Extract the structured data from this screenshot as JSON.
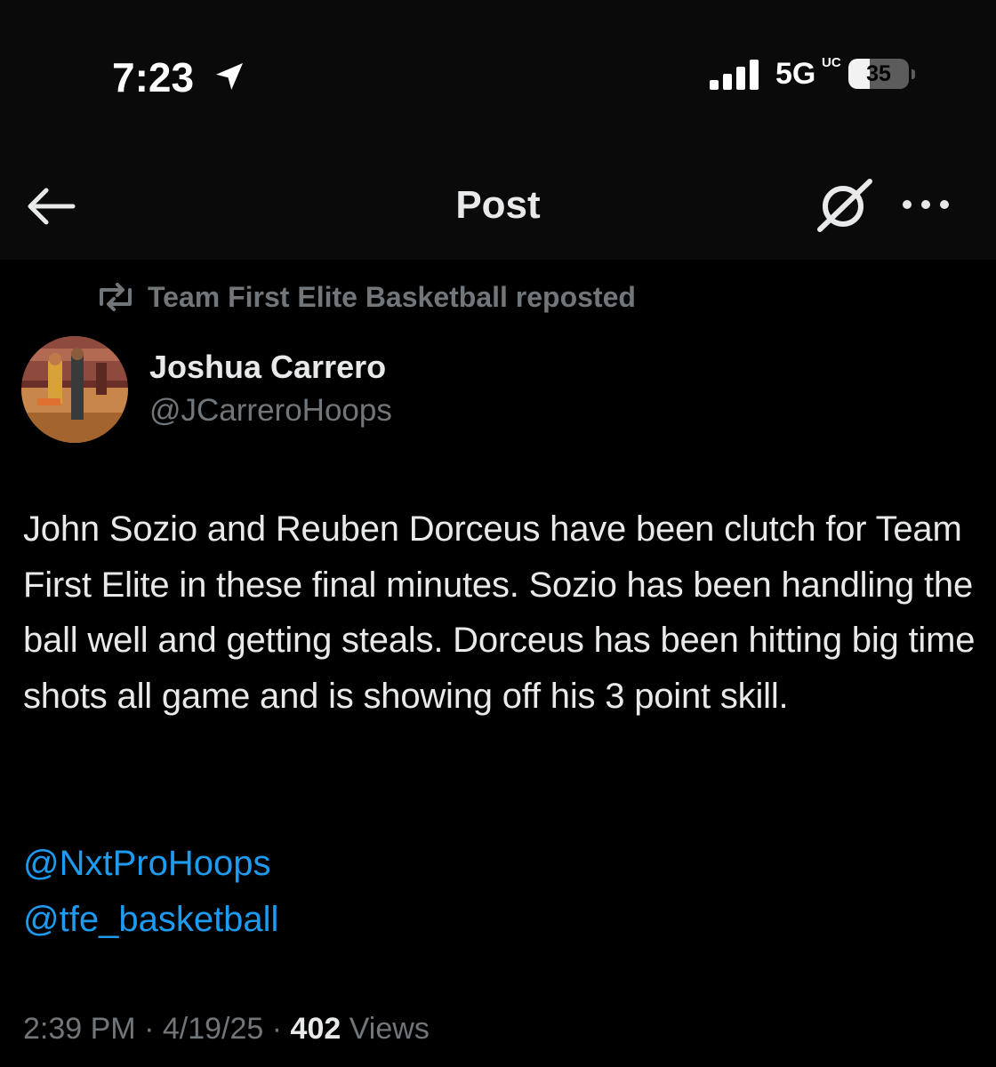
{
  "status_bar": {
    "time": "7:23",
    "location_icon": "location-arrow-icon",
    "signal_icon": "cellular-signal-icon",
    "network": "5G",
    "network_suffix": "UC",
    "battery_level": "35",
    "battery_fraction": 0.35
  },
  "nav": {
    "back_icon": "back-arrow-icon",
    "title": "Post",
    "grok_icon": "grok-icon",
    "more_icon": "more-horizontal-icon"
  },
  "post": {
    "repost_icon": "repost-icon",
    "repost_label": "Team First Elite Basketball reposted",
    "author_name": "Joshua Carrero",
    "author_handle": "@JCarreroHoops",
    "body": "John Sozio and Reuben Dorceus have been clutch for Team First Elite in these final minutes. Sozio has been handling the ball well and getting steals. Dorceus has been hitting big time shots all game and is showing off his 3 point skill.",
    "mentions": [
      "@NxtProHoops",
      "@tfe_basketball"
    ],
    "time": "2:39 PM",
    "separator": "·",
    "date": "4/19/25",
    "views_count": "402",
    "views_label": "Views"
  },
  "colors": {
    "background": "#000000",
    "text_primary": "#e7e9ea",
    "text_secondary": "#71767b",
    "link": "#1d9bf0"
  }
}
